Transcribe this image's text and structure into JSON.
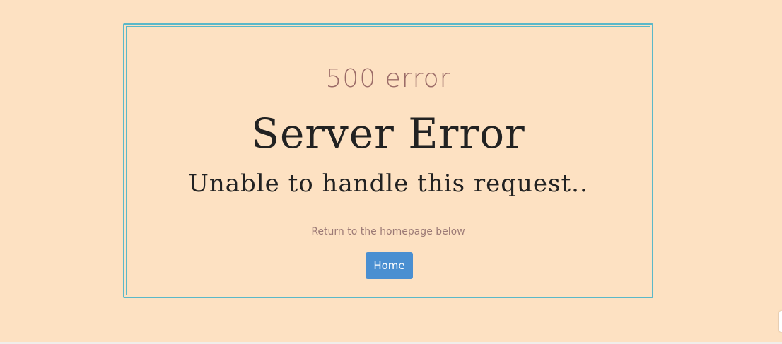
{
  "error": {
    "code_text": "500 error",
    "title": "Server Error",
    "subtitle": "Unable to handle this request..",
    "return_text": "Return to the homepage below",
    "home_button_label": "Home"
  },
  "colors": {
    "background": "#fde1c2",
    "frame_border": "#5bb8c8",
    "button_bg": "#4a8fd1",
    "divider": "#e9a865",
    "muted_text": "#9c6c68"
  }
}
